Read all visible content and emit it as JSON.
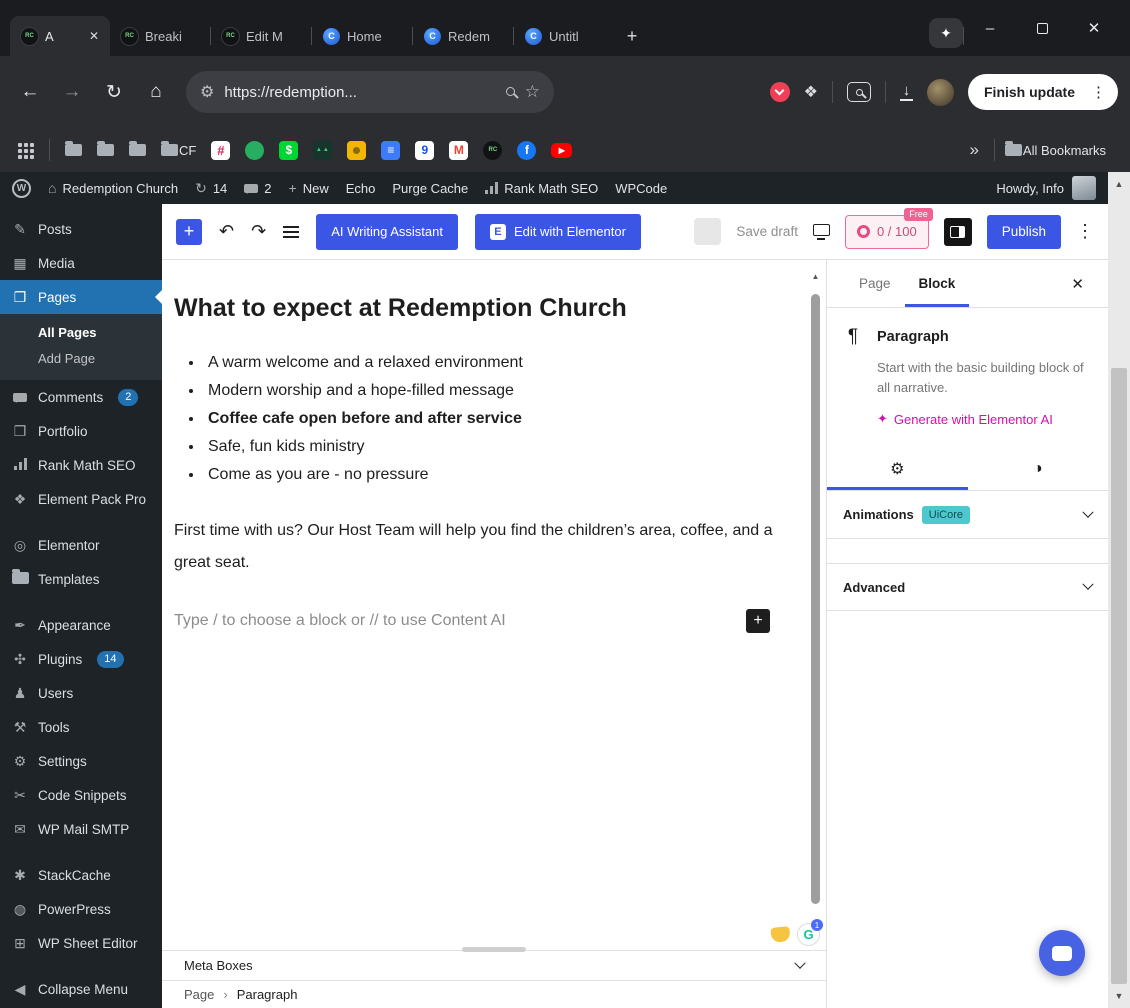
{
  "colors": {
    "wp_blue": "#2271b1",
    "editor_blue": "#3b56e4",
    "rankmath_pink": "#ee6b93",
    "uicore_teal": "#4ec8ce",
    "elementor_ai_pink": "#d30fae"
  },
  "icons": {
    "w": "W",
    "rc": "RC",
    "c": "C",
    "slack": "#",
    "cash": "$",
    "nine": "9",
    "gmail": "M",
    "facebook": "f",
    "youtube": "▶",
    "docs": "≡",
    "forest": "▲▲",
    "tune": "⚙",
    "puzzle": "❖",
    "star": "☆",
    "back": "←",
    "forward": "→",
    "reload": "↻",
    "home": "⌂",
    "plus": "+",
    "undo": "↶",
    "redo": "↷",
    "kebab": "⋮",
    "close": "✕",
    "minimize": "–",
    "sparkle": "✦",
    "chevrons": "»",
    "chevron_right": "›",
    "up": "▲",
    "down": "▼",
    "gear": "⚙",
    "styles": "◑",
    "paragraph": "¶",
    "elementor_e": "E",
    "grammarly_g": "G",
    "ai_sparkle": "✦",
    "wp_update": "↻",
    "sb_posts": "✎",
    "sb_media": "▦",
    "sb_pages": "❐",
    "sb_portfolio": "❒",
    "sb_element_pack": "❖",
    "sb_elementor": "◎",
    "sb_appearance": "✒",
    "sb_plugins": "✣",
    "sb_users": "♟",
    "sb_tools": "⚒",
    "sb_settings": "⚙",
    "sb_code": "✂",
    "sb_mail": "✉",
    "sb_stackcache": "✱",
    "sb_powerpress": "◍",
    "sb_sheet": "⊞",
    "sb_collapse": "◀"
  },
  "browser": {
    "tabs": [
      {
        "title": "A"
      },
      {
        "title": "Breaki"
      },
      {
        "title": "Edit M"
      },
      {
        "title": "Home"
      },
      {
        "title": "Redem"
      },
      {
        "title": "Untitl"
      }
    ],
    "address": "https://redemption...",
    "update_button": "Finish update",
    "bookmarks": {
      "cf_folder": "CF",
      "all_bookmarks": "All Bookmarks"
    }
  },
  "admin_bar": {
    "site_name": "Redemption Church",
    "updates_count": "14",
    "comments_count": "2",
    "new_label": "New",
    "echo": "Echo",
    "purge_cache": "Purge Cache",
    "rank_math": "Rank Math SEO",
    "wpcode": "WPCode",
    "howdy": "Howdy, Info"
  },
  "sidebar": {
    "items": [
      {
        "label": "Posts"
      },
      {
        "label": "Media"
      },
      {
        "label": "Pages"
      },
      {
        "label": "Comments",
        "badge": "2"
      },
      {
        "label": "Portfolio"
      },
      {
        "label": "Rank Math SEO"
      },
      {
        "label": "Element Pack Pro"
      },
      {
        "label": "Elementor"
      },
      {
        "label": "Templates"
      },
      {
        "label": "Appearance"
      },
      {
        "label": "Plugins",
        "badge": "14"
      },
      {
        "label": "Users"
      },
      {
        "label": "Tools"
      },
      {
        "label": "Settings"
      },
      {
        "label": "Code Snippets"
      },
      {
        "label": "WP Mail SMTP"
      },
      {
        "label": "StackCache"
      },
      {
        "label": "PowerPress"
      },
      {
        "label": "WP Sheet Editor"
      },
      {
        "label": "Collapse Menu"
      }
    ],
    "submenu": {
      "all_pages": "All Pages",
      "add_page": "Add Page"
    }
  },
  "toolbar": {
    "ai_writing_assistant": "AI Writing Assistant",
    "edit_with_elementor": "Edit with Elementor",
    "save_draft": "Save draft",
    "seo_score": "0 / 100",
    "seo_badge": "Free",
    "publish": "Publish"
  },
  "content": {
    "title": "What to expect at Redemption Church",
    "bullets": [
      "A warm welcome and a relaxed environment",
      "Modern worship and a hope-filled message",
      "Coffee cafe open before and after service",
      "Safe, fun kids ministry",
      "Come as you are - no pressure"
    ],
    "paragraph": "First time with us? Our Host Team will help you find the children’s area, coffee, and a great seat.",
    "placeholder": "Type / to choose a block or // to use Content AI"
  },
  "footer": {
    "meta_boxes": "Meta Boxes",
    "breadcrumb_page": "Page",
    "breadcrumb_block": "Paragraph"
  },
  "panel": {
    "tab_page": "Page",
    "tab_block": "Block",
    "block_name": "Paragraph",
    "block_description": "Start with the basic building block of all narrative.",
    "ai_link": "Generate with Elementor AI",
    "animations_label": "Animations",
    "animations_badge": "UiCore",
    "advanced_label": "Advanced"
  },
  "grammarly": {
    "badge": "1"
  }
}
